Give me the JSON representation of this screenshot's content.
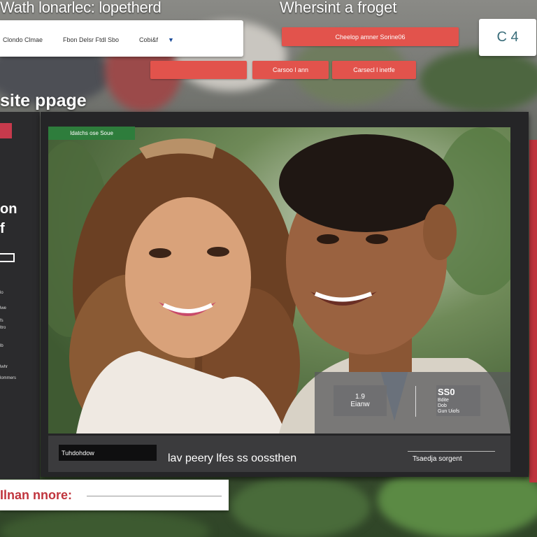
{
  "header": {
    "left_title": "Wath lonarlec: lopetherd",
    "right_title": "Whersint a froget"
  },
  "search": {
    "field1": "Clondo Clmae",
    "field2": "Fbon Delsr Ftdl Sbo",
    "field3": "Cobi&f",
    "dropdown_icon": "chevron-down-icon"
  },
  "buttons": {
    "top_right": "Cheelop amner Sorine06",
    "b2": "Carsoo l ann",
    "b3": "Carsecl l inetfe"
  },
  "counter": {
    "value": "C 4"
  },
  "page": {
    "title": "site ppage"
  },
  "left_panel": {
    "line1": "on",
    "line2": "f",
    "small_items": [
      "lo",
      "lwe",
      "fs",
      "ltro",
      "lb",
      "lwhr",
      "lommers"
    ]
  },
  "photo": {
    "tag": "Idatchs ose Soue"
  },
  "stats": {
    "left_value": "1.9",
    "left_label": "Eianw",
    "right_value": "SS0",
    "right_lines": [
      "Bdite",
      "Dob",
      "Gun"
    ],
    "right_suffix": "Uiofs"
  },
  "bottom": {
    "chip": "Tuhdohdow",
    "caption": "lav peery lfes ss oossthen",
    "link": "Tsaedja sorgent"
  },
  "cta": {
    "label": "Ilnan nnore:"
  },
  "colors": {
    "accent_red": "#e2534c",
    "strip_red": "#c0343d",
    "panel_dark": "#2b2b2d",
    "tag_green": "#2e7d3c"
  }
}
